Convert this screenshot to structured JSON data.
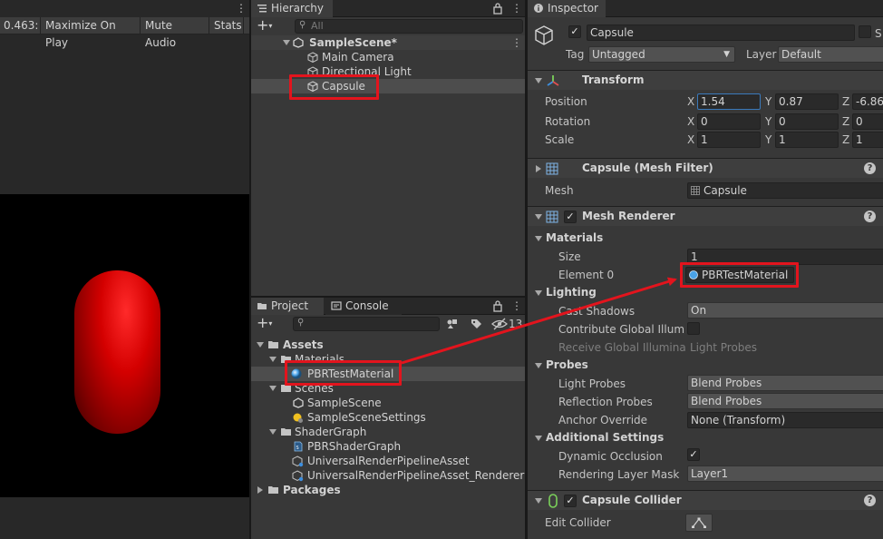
{
  "game": {
    "toolbar": {
      "scale_value": "0.463:",
      "maximize": "Maximize On Play",
      "mute": "Mute Audio",
      "stats": "Stats"
    }
  },
  "hierarchy": {
    "tab_label": "Hierarchy",
    "search_placeholder": "All",
    "scene": "SampleScene*",
    "items": [
      "Main Camera",
      "Directional Light",
      "Capsule"
    ]
  },
  "project": {
    "tab_project": "Project",
    "tab_console": "Console",
    "hidden_count": "13",
    "tree": {
      "assets": "Assets",
      "materials": "Materials",
      "material_item": "PBRTestMaterial",
      "scenes": "Scenes",
      "scene_item": "SampleScene",
      "scene_settings": "SampleSceneSettings",
      "shadergraph": "ShaderGraph",
      "sg_items": [
        "PBRShaderGraph",
        "UniversalRenderPipelineAsset",
        "UniversalRenderPipelineAsset_Renderer"
      ],
      "packages": "Packages"
    }
  },
  "inspector": {
    "tab_label": "Inspector",
    "object_name": "Capsule",
    "static_label": "S",
    "tag_label": "Tag",
    "tag_value": "Untagged",
    "layer_label": "Layer",
    "layer_value": "Default",
    "transform": {
      "title": "Transform",
      "position_label": "Position",
      "rotation_label": "Rotation",
      "scale_label": "Scale",
      "axis_x": "X",
      "axis_y": "Y",
      "axis_z": "Z",
      "position": [
        "1.54",
        "0.87",
        "-6.86"
      ],
      "rotation": [
        "0",
        "0",
        "0"
      ],
      "scale": [
        "1",
        "1",
        "1"
      ]
    },
    "mesh_filter": {
      "title": "Capsule (Mesh Filter)",
      "mesh_label": "Mesh",
      "mesh_value": "Capsule"
    },
    "mesh_renderer": {
      "title": "Mesh Renderer",
      "materials_label": "Materials",
      "size_label": "Size",
      "size_value": "1",
      "element0_label": "Element 0",
      "element0_value": "PBRTestMaterial",
      "lighting_label": "Lighting",
      "cast_shadows_label": "Cast Shadows",
      "cast_shadows_value": "On",
      "contribute_gi_label": "Contribute Global Illumina",
      "receive_gi_label": "Receive Global Illuminatio",
      "receive_gi_value": "Light Probes",
      "probes_label": "Probes",
      "light_probes_label": "Light Probes",
      "light_probes_value": "Blend Probes",
      "reflection_probes_label": "Reflection Probes",
      "reflection_probes_value": "Blend Probes",
      "anchor_override_label": "Anchor Override",
      "anchor_override_value": "None (Transform)",
      "additional_label": "Additional Settings",
      "dynamic_occlusion_label": "Dynamic Occlusion",
      "rendering_layer_label": "Rendering Layer Mask",
      "rendering_layer_value": "Layer1"
    },
    "capsule_collider": {
      "title": "Capsule Collider",
      "edit_collider_label": "Edit Collider"
    }
  },
  "colors": {
    "annotation": "#e3141d",
    "capsule": "#d40000",
    "selection_highlight": "#4d4d4d"
  }
}
